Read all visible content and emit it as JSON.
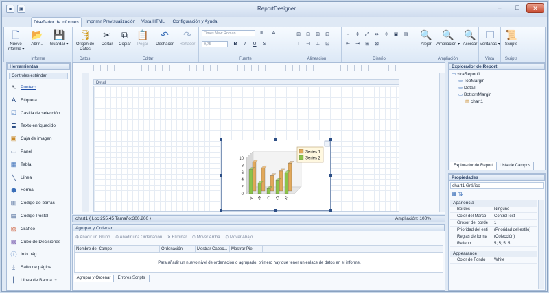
{
  "title": "ReportDesigner",
  "window_controls": {
    "minimize": "–",
    "maximize": "□",
    "close": "✕"
  },
  "quick_access": {
    "app_glyph": "■",
    "save_glyph": "▣"
  },
  "tabs": [
    "Diseñador de informes",
    "Imprimir Previsualización",
    "Vista HTML",
    "Configuración y Ayuda"
  ],
  "ribbon": {
    "informe": {
      "label": "Informe",
      "nuevo": "Nuevo informe ▾",
      "abrir": "Abrir...",
      "guardar": "Guardar ▾"
    },
    "datos": {
      "label": "Datos",
      "origen": "Origen de Datos"
    },
    "editar": {
      "label": "Editar",
      "cortar": "Cortar",
      "copiar": "Copiar",
      "pegar": "Pegar",
      "deshacer": "Deshacer",
      "rehacer": "Rehacer"
    },
    "fuente": {
      "label": "Fuente",
      "font_placeholder": "Times New Roman",
      "size_placeholder": "9,75",
      "bold": "B",
      "italic": "I",
      "underline": "U",
      "strike": "S"
    },
    "alineacion": {
      "label": "Alineación"
    },
    "diseno": {
      "label": "Diseño"
    },
    "ampliacion": {
      "label": "Ampliación",
      "alejar": "Alejar",
      "ampliacion": "Ampliación ▾",
      "acercar": "Acercar"
    },
    "vista": {
      "label": "Vista",
      "ventanas": "Ventanas ▾"
    },
    "scripts": {
      "label": "Scripts",
      "scripts": "Scripts"
    }
  },
  "toolbox": {
    "title": "Herramientas",
    "section": "Controles estándar",
    "items": [
      "Puntero",
      "Etiqueta",
      "Casilla de selección",
      "Texto enriquecido",
      "Caja de imagen",
      "Panel",
      "Tabla",
      "Línea",
      "Forma",
      "Código de barras",
      "Código Postal",
      "Gráfico",
      "Cubo de Decisiones",
      "Info pág",
      "Salto de página",
      "Línea de Banda cr..."
    ]
  },
  "design": {
    "section_label": "Detail",
    "status_left": "chart1 { Loc:255,45 Tamaño:300,200 }",
    "status_right": "Ampliación: 100%"
  },
  "chart_data": {
    "type": "bar",
    "categories": [
      "A",
      "B",
      "C",
      "D",
      "E"
    ],
    "y_ticks": [
      "10",
      "8",
      "6",
      "4",
      "2",
      "0"
    ],
    "series": [
      {
        "name": "Series 1",
        "values": [
          8.2,
          6.5,
          4.3,
          5.6,
          7.8
        ]
      },
      {
        "name": "Series 2",
        "values": [
          6.8,
          3.0,
          1.5,
          3.8,
          5.9
        ]
      }
    ],
    "ylim": [
      0,
      10
    ],
    "colors": [
      "#e2a85a",
      "#8bc34a"
    ],
    "legend": "top-right"
  },
  "group_panel": {
    "title": "Agrupar y Ordenar",
    "toolbar": [
      "Añadir un Grupo",
      "Añadir una Ordenación",
      "Eliminar",
      "Mover Arriba",
      "Mover Abajo"
    ],
    "columns": [
      "Nombre del Campo",
      "Ordenación",
      "Mostrar Cabec...",
      "Mostrar Pie"
    ],
    "message": "Para añadir un nuevo nivel de ordenación o agrupado, primero hay que tener un enlace de datos en el informe.",
    "tabs": [
      "Agrupar y Ordenar",
      "Errores Scripts"
    ]
  },
  "explorer": {
    "title": "Explorador de Report",
    "items": [
      {
        "label": "xtraReport1",
        "indent": 0
      },
      {
        "label": "TopMargin",
        "indent": 1
      },
      {
        "label": "Detail",
        "indent": 1
      },
      {
        "label": "BottomMargin",
        "indent": 1
      },
      {
        "label": "chart1",
        "indent": 2
      }
    ],
    "tabs": [
      "Explorador de Report",
      "Lista de Campos"
    ]
  },
  "properties": {
    "title": "Propiedades",
    "object": "chart1  Gráfico",
    "cat1": "Apariencia",
    "rows": [
      {
        "name": "Bordes",
        "value": "Ninguno"
      },
      {
        "name": "Color del Marco",
        "value": "ControlText"
      },
      {
        "name": "Grosor del borde",
        "value": "1"
      },
      {
        "name": "Prioridad del esti",
        "value": "(Prioridad del estilo)"
      },
      {
        "name": "Reglas de forma",
        "value": "(Colección)"
      },
      {
        "name": "Relleno",
        "value": "5; 5; 5; 5"
      }
    ],
    "cat2": "Appearance",
    "rows2": [
      {
        "name": "Color de Fondo",
        "value": "White"
      }
    ]
  }
}
